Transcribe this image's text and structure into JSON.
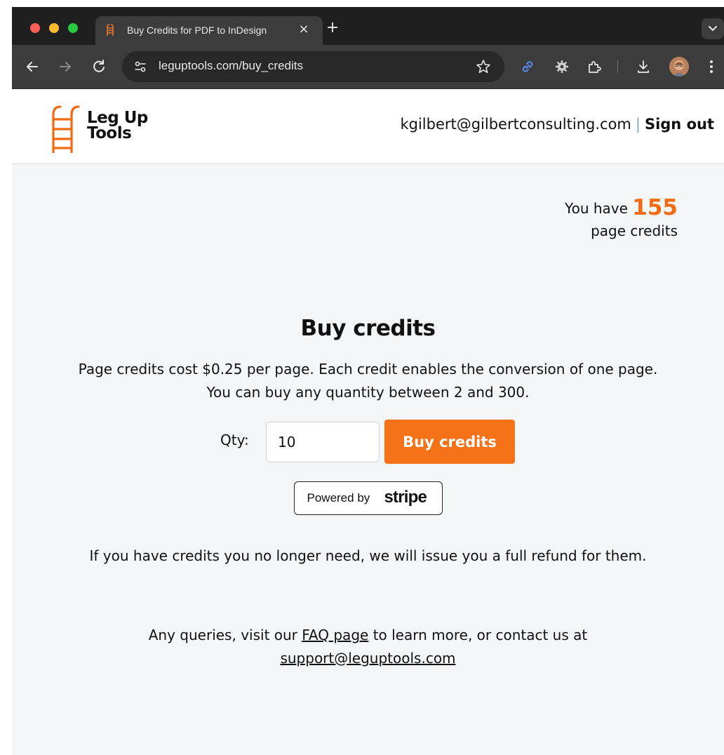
{
  "browser": {
    "tab_title": "Buy Credits for PDF to InDesign",
    "url": "leguptools.com/buy_credits",
    "colors": {
      "frame": "#1f1f1f",
      "toolbar": "#3c3c3c",
      "omnibox": "#282828"
    }
  },
  "header": {
    "logo_line1": "Leg Up",
    "logo_line2": "Tools",
    "user_email": "kgilbert@gilbertconsulting.com",
    "separator": "|",
    "sign_out_label": "Sign out"
  },
  "balance": {
    "prefix": "You have",
    "count": "155",
    "suffix": "page credits"
  },
  "main": {
    "title": "Buy credits",
    "price_text": "Page credits cost $0.25 per page. Each credit enables the conversion of one page.",
    "quantity_text": "You can buy any quantity between 2 and 300.",
    "qty_label": "Qty:",
    "qty_value": "10",
    "buy_button_label": "Buy credits",
    "stripe_prefix": "Powered by",
    "stripe_brand": "stripe",
    "refund_text": "If you have credits you no longer need, we will issue you a full refund for them.",
    "queries_pre": "Any queries, visit our",
    "faq_link": "FAQ page",
    "queries_mid": "to learn more, or contact us at",
    "support_email": "support@leguptools.com"
  },
  "colors": {
    "accent": "#f57218",
    "page_bg": "#f4f5f7"
  }
}
